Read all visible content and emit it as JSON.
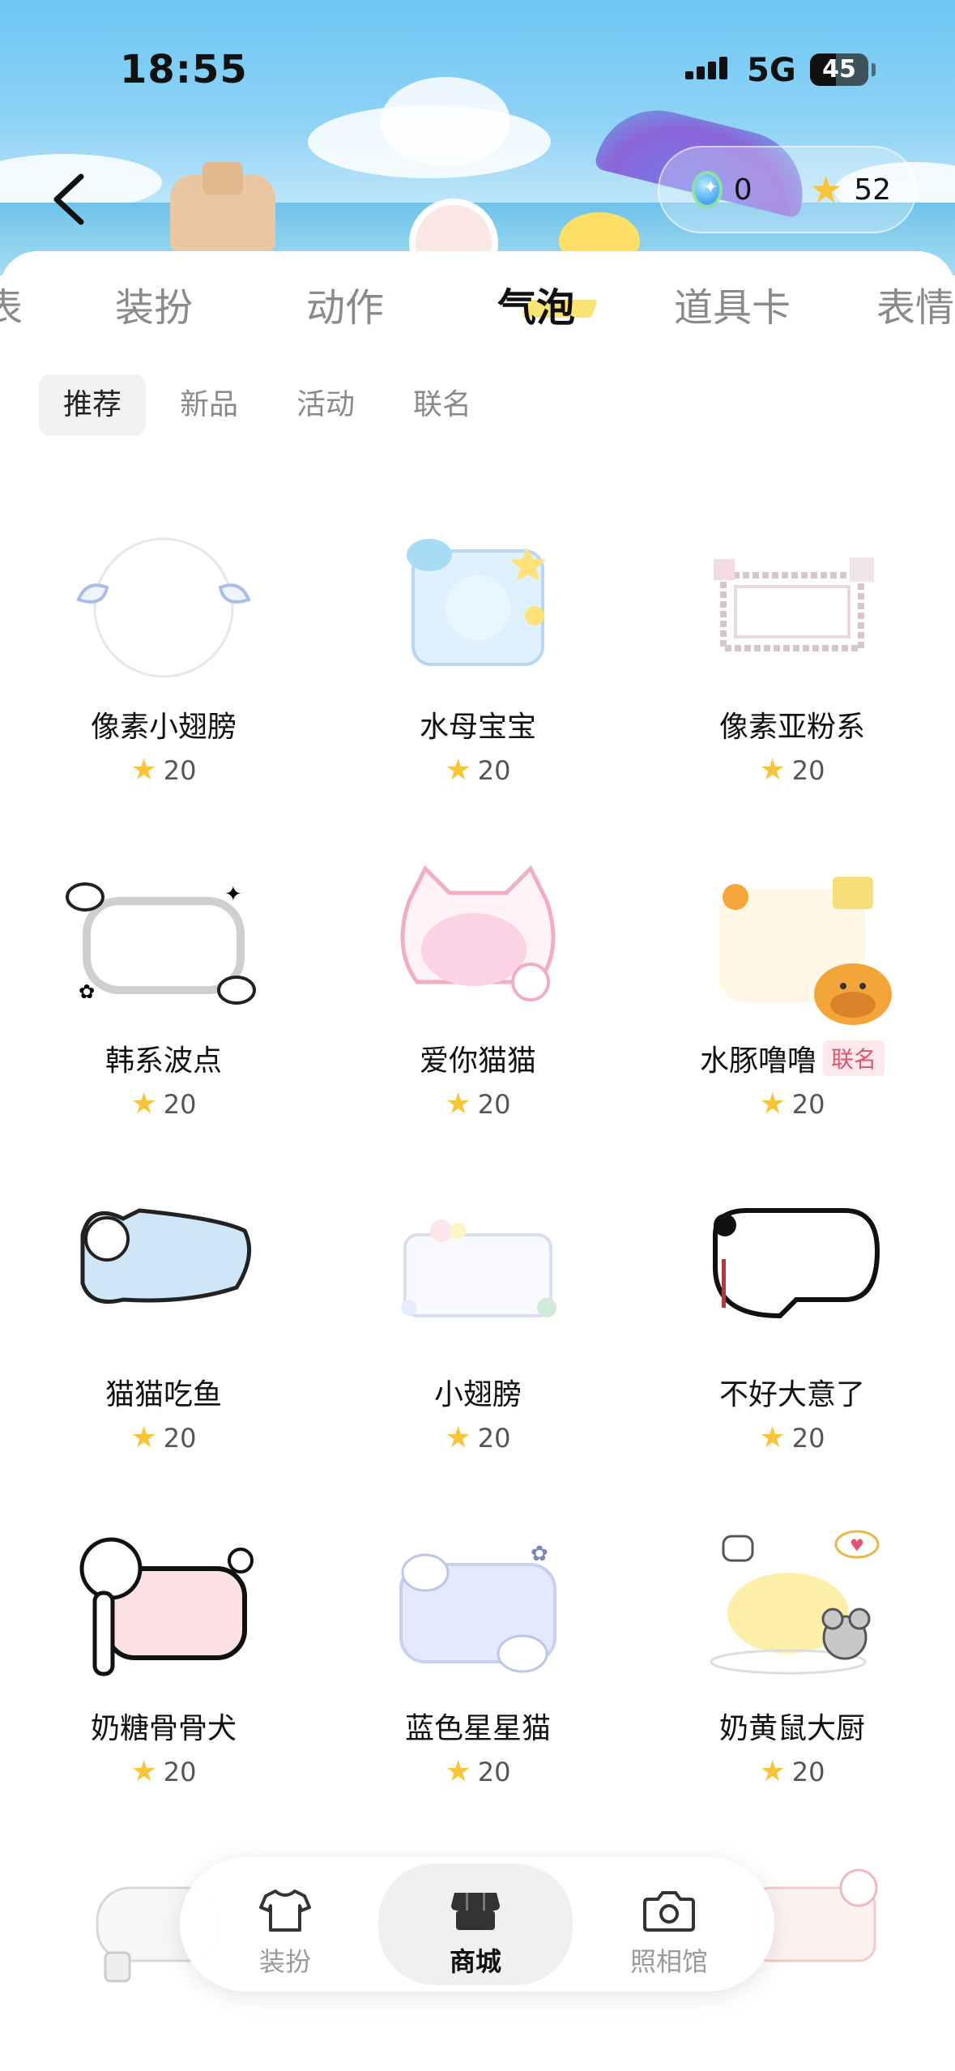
{
  "status_bar": {
    "time": "18:55",
    "network": "5G",
    "battery": "45"
  },
  "currency": {
    "gem_value": "0",
    "star_value": "52"
  },
  "tabs": [
    {
      "label": "装扮",
      "active": false
    },
    {
      "label": "动作",
      "active": false
    },
    {
      "label": "气泡",
      "active": true
    },
    {
      "label": "道具卡",
      "active": false
    },
    {
      "label": "表情",
      "active": false
    }
  ],
  "subtabs": [
    {
      "label": "推荐",
      "active": true
    },
    {
      "label": "新品",
      "active": false
    },
    {
      "label": "活动",
      "active": false
    },
    {
      "label": "联名",
      "active": false
    }
  ],
  "items": [
    {
      "name": "像素小翅膀",
      "price": "20",
      "style": "wings-pixel"
    },
    {
      "name": "水母宝宝",
      "price": "20",
      "style": "jelly"
    },
    {
      "name": "像素亚粉系",
      "price": "20",
      "style": "pixel-pink"
    },
    {
      "name": "韩系波点",
      "price": "20",
      "style": "korean"
    },
    {
      "name": "爱你猫猫",
      "price": "20",
      "style": "cat-pink"
    },
    {
      "name": "水豚噜噜",
      "price": "20",
      "tag": "联名",
      "style": "capybara"
    },
    {
      "name": "猫猫吃鱼",
      "price": "20",
      "style": "cat-fish"
    },
    {
      "name": "小翅膀",
      "price": "20",
      "style": "wings"
    },
    {
      "name": "不好大意了",
      "price": "20",
      "style": "panda"
    },
    {
      "name": "奶糖骨骨犬",
      "price": "20",
      "style": "dog"
    },
    {
      "name": "蓝色星星猫",
      "price": "20",
      "style": "blue-cat"
    },
    {
      "name": "奶黄鼠大厨",
      "price": "20",
      "style": "mouse-chef"
    }
  ],
  "nav": [
    {
      "label": "装扮",
      "icon": "shirt-icon",
      "active": false
    },
    {
      "label": "商城",
      "icon": "store-icon",
      "active": true
    },
    {
      "label": "照相馆",
      "icon": "camera-icon",
      "active": false
    }
  ],
  "colors": {
    "star": "#f7c43a",
    "tag_text": "#e0556e",
    "tag_bg": "#fde8ec",
    "active_tab_highlight": "#f8de5a"
  }
}
